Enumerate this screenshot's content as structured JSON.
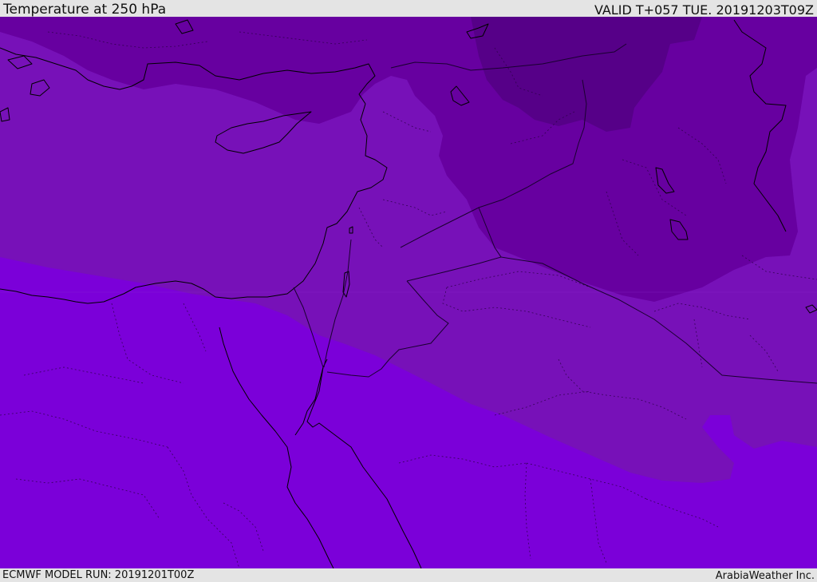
{
  "header": {
    "title": "Temperature at 250 hPa",
    "valid_time": "VALID T+057 TUE. 20191203T09Z"
  },
  "footer": {
    "model_run": "ECMWF MODEL RUN: 20191201T00Z",
    "credit": "ArabiaWeather Inc."
  },
  "colors": {
    "band_warmest": "#7b00d9",
    "band_mid": "#7711b8",
    "band_cool": "#6700a0",
    "band_coldest": "#560088",
    "coastline": "#000000",
    "border": "#1a0030",
    "bar_background": "#e4e4e4"
  }
}
